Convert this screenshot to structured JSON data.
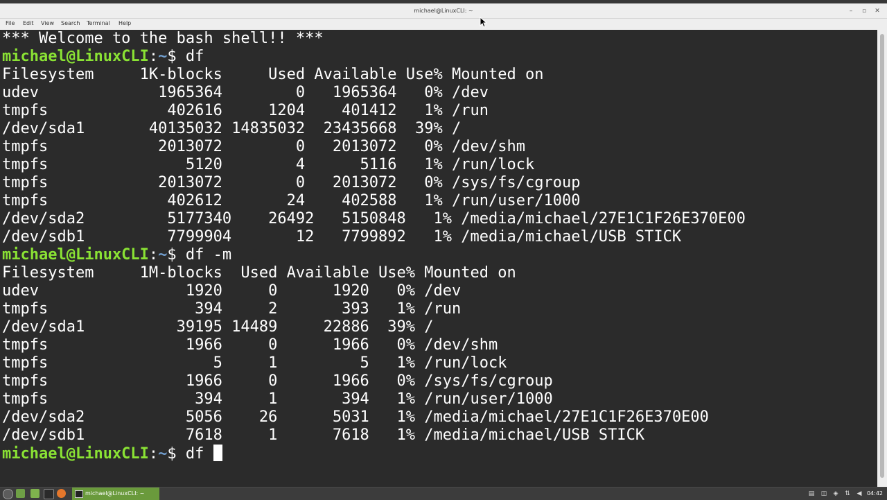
{
  "window": {
    "title": "michael@LinuxCLI: ~"
  },
  "menu": {
    "items": [
      "File",
      "Edit",
      "View",
      "Search",
      "Terminal",
      "Help"
    ]
  },
  "terminal": {
    "lines": [
      [
        {
          "text": "*** Welcome to the bash shell!! ***",
          "cls": ""
        }
      ],
      [
        {
          "text": "michael@LinuxCLI",
          "cls": "prompt-user"
        },
        {
          "text": ":",
          "cls": "prompt-sep"
        },
        {
          "text": "~",
          "cls": "prompt-path"
        },
        {
          "text": "$ df",
          "cls": ""
        }
      ],
      [
        {
          "text": "Filesystem     1K-blocks     Used Available Use% Mounted on",
          "cls": ""
        }
      ],
      [
        {
          "text": "udev             1965364        0   1965364   0% /dev",
          "cls": ""
        }
      ],
      [
        {
          "text": "tmpfs             402616     1204    401412   1% /run",
          "cls": ""
        }
      ],
      [
        {
          "text": "/dev/sda1       40135032 14835032  23435668  39% /",
          "cls": ""
        }
      ],
      [
        {
          "text": "tmpfs            2013072        0   2013072   0% /dev/shm",
          "cls": ""
        }
      ],
      [
        {
          "text": "tmpfs               5120        4      5116   1% /run/lock",
          "cls": ""
        }
      ],
      [
        {
          "text": "tmpfs            2013072        0   2013072   0% /sys/fs/cgroup",
          "cls": ""
        }
      ],
      [
        {
          "text": "tmpfs             402612       24    402588   1% /run/user/1000",
          "cls": ""
        }
      ],
      [
        {
          "text": "/dev/sda2         5177340    26492   5150848   1% /media/michael/27E1C1F26E370E00",
          "cls": ""
        }
      ],
      [
        {
          "text": "/dev/sdb1         7799904       12   7799892   1% /media/michael/USB STICK",
          "cls": ""
        }
      ],
      [
        {
          "text": "michael@LinuxCLI",
          "cls": "prompt-user"
        },
        {
          "text": ":",
          "cls": "prompt-sep"
        },
        {
          "text": "~",
          "cls": "prompt-path"
        },
        {
          "text": "$ df -m",
          "cls": ""
        }
      ],
      [
        {
          "text": "Filesystem     1M-blocks  Used Available Use% Mounted on",
          "cls": ""
        }
      ],
      [
        {
          "text": "udev                1920     0      1920   0% /dev",
          "cls": ""
        }
      ],
      [
        {
          "text": "tmpfs                394     2       393   1% /run",
          "cls": ""
        }
      ],
      [
        {
          "text": "/dev/sda1          39195 14489     22886  39% /",
          "cls": ""
        }
      ],
      [
        {
          "text": "tmpfs               1966     0      1966   0% /dev/shm",
          "cls": ""
        }
      ],
      [
        {
          "text": "tmpfs                  5     1         5   1% /run/lock",
          "cls": ""
        }
      ],
      [
        {
          "text": "tmpfs               1966     0      1966   0% /sys/fs/cgroup",
          "cls": ""
        }
      ],
      [
        {
          "text": "tmpfs                394     1       394   1% /run/user/1000",
          "cls": ""
        }
      ],
      [
        {
          "text": "/dev/sda2           5056    26      5031   1% /media/michael/27E1C1F26E370E00",
          "cls": ""
        }
      ],
      [
        {
          "text": "/dev/sdb1           7618     1      7618   1% /media/michael/USB STICK",
          "cls": ""
        }
      ],
      [
        {
          "text": "michael@LinuxCLI",
          "cls": "prompt-user"
        },
        {
          "text": ":",
          "cls": "prompt-sep"
        },
        {
          "text": "~",
          "cls": "prompt-path"
        },
        {
          "text": "$ df ",
          "cls": ""
        },
        {
          "text": "",
          "cls": "cursor"
        }
      ]
    ]
  },
  "taskbar": {
    "task_label": "michael@LinuxCLI: ~",
    "clock": "04:42"
  },
  "colors": {
    "terminal_bg": "#2b2b2b",
    "prompt_user": "#8ae234",
    "prompt_path": "#729fcf",
    "task_active": "#6a9a3c"
  }
}
